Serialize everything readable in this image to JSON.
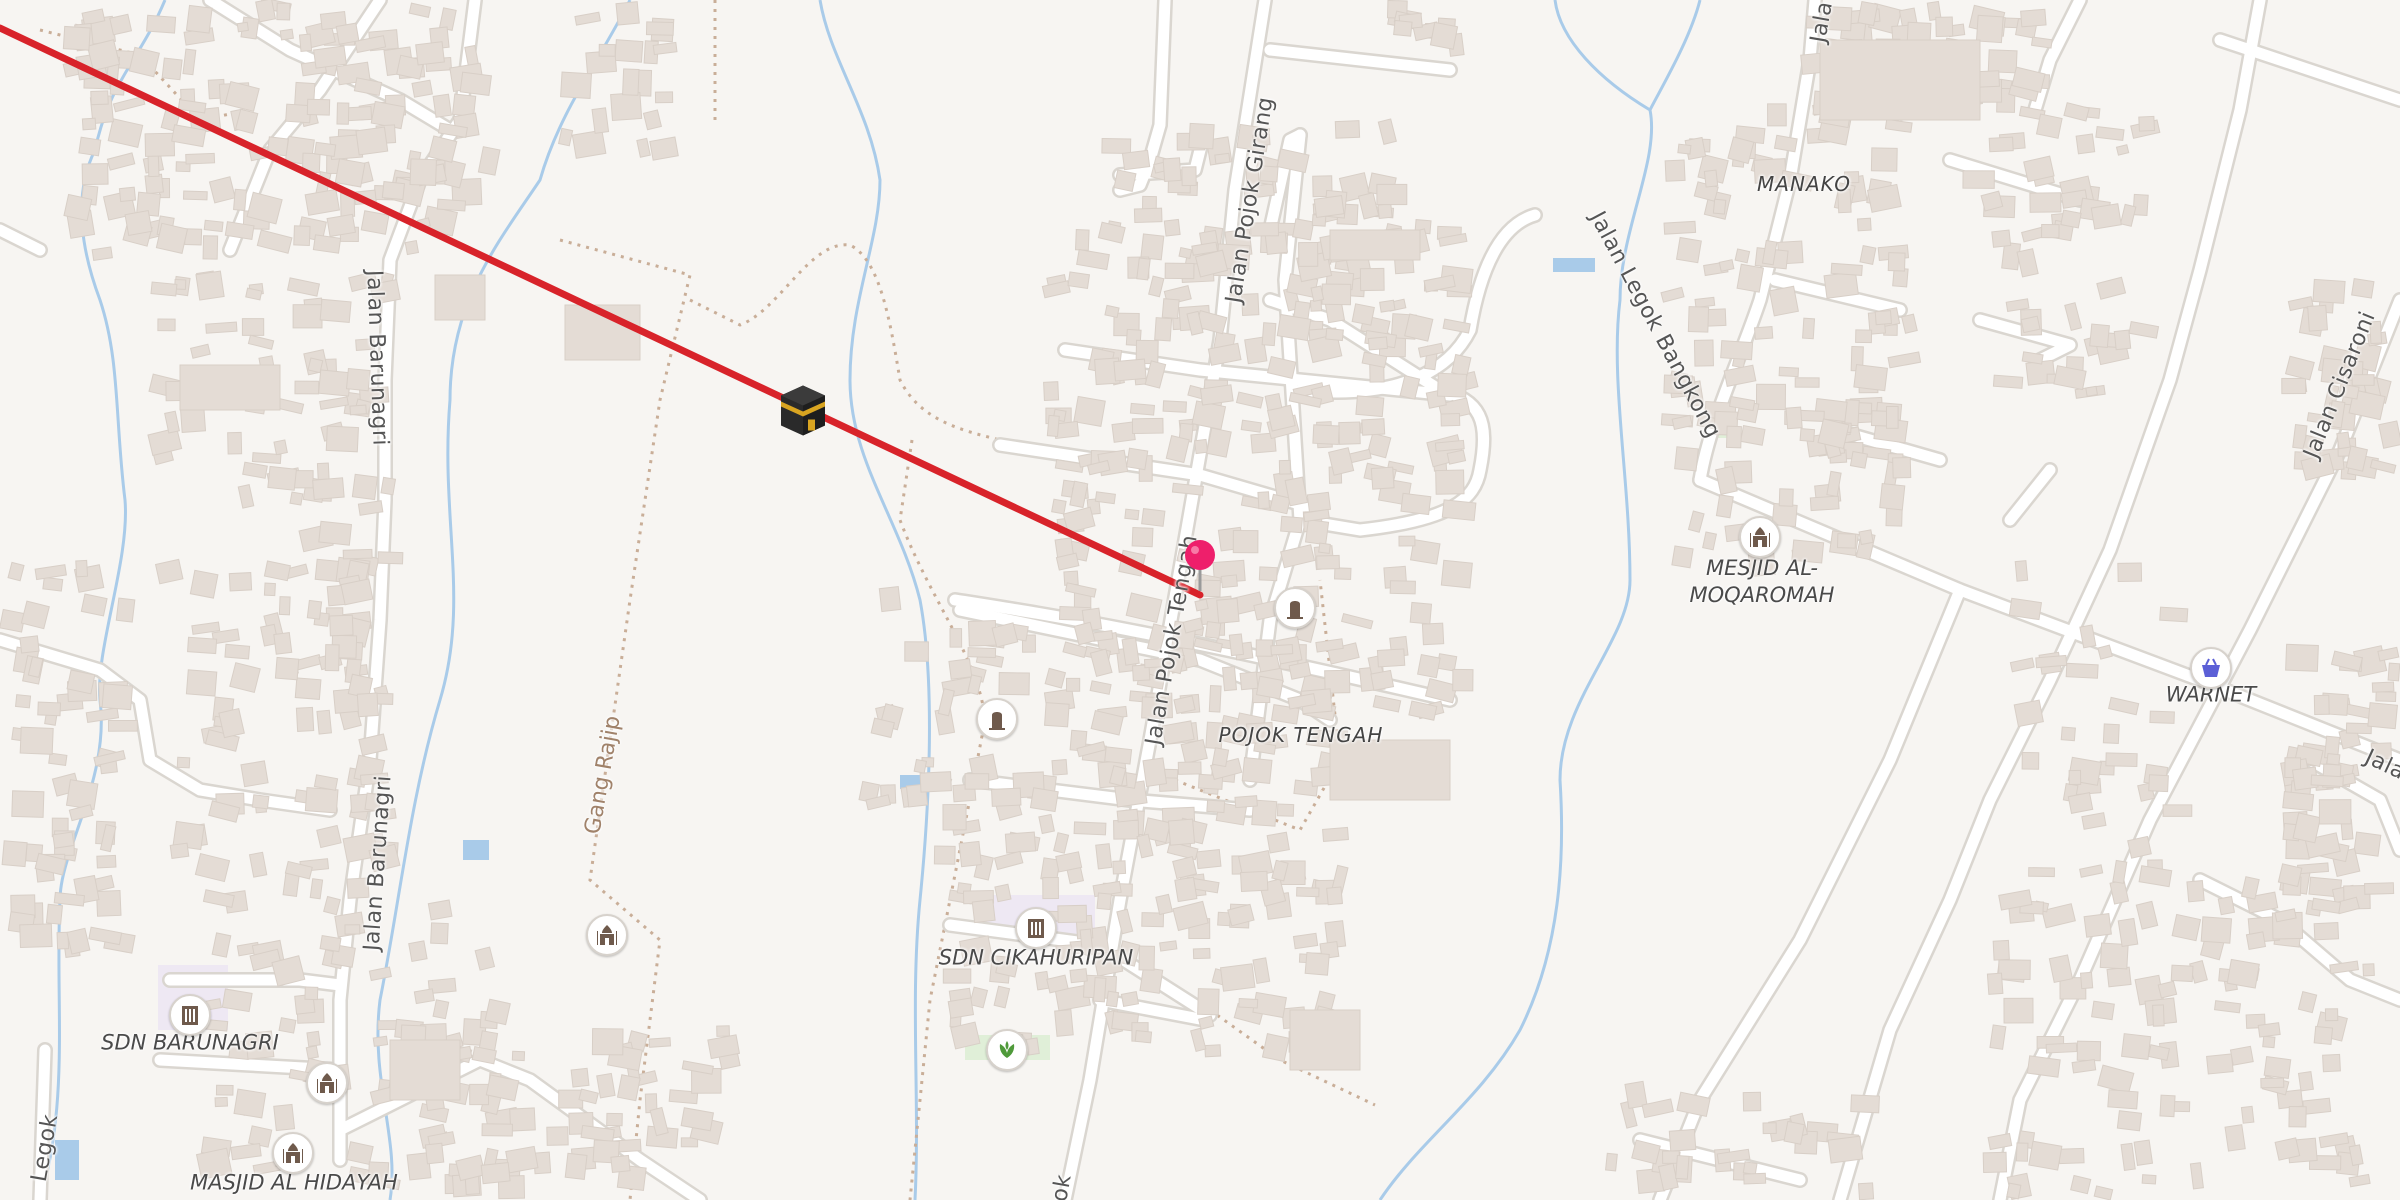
{
  "map": {
    "colors": {
      "background": "#f7f5f2",
      "building": "#e4dcd5",
      "road": "#ffffff",
      "road_casing": "#dad6d0",
      "water": "#a9cbe9",
      "footpath": "#c9ae98",
      "direction_line": "#d8232a",
      "pin": "#ee1f6b"
    },
    "places": [
      {
        "name": "POJOK TENGAH",
        "type": "locality"
      },
      {
        "name": "MANAKO",
        "type": "locality"
      }
    ],
    "roads": [
      {
        "name": "Jalan Pojok Girang"
      },
      {
        "name": "Jalan Pojok Tengah"
      },
      {
        "name": "Jalan Legok Bangkong"
      },
      {
        "name": "Jalan Barunagri"
      },
      {
        "name": "Jalan Barunagri"
      },
      {
        "name": "Jalan Cisaroni"
      },
      {
        "name": "Jala"
      },
      {
        "name": "Jala"
      },
      {
        "name": "Legok"
      },
      {
        "name": "ok"
      }
    ],
    "paths": [
      {
        "name": "Gang Rajip"
      }
    ],
    "pois": [
      {
        "name": "MESJID AL-\nMOQAROMAH",
        "icon": "mosque-icon"
      },
      {
        "name": "SDN CIKAHURIPAN",
        "icon": "school-icon"
      },
      {
        "name": "SDN BARUNAGRI",
        "icon": "school-icon"
      },
      {
        "name": "MASJID AL HIDAYAH",
        "icon": "mosque-icon"
      },
      {
        "name": "WARNET",
        "icon": "shop-basket-icon"
      }
    ],
    "unlabeled_icons": [
      "mosque-icon",
      "cemetery-icon",
      "cemetery-icon",
      "garden-icon"
    ],
    "qibla_marker": {
      "icon": "kaaba-icon"
    },
    "location_pin": {
      "icon": "map-pin-icon"
    }
  }
}
